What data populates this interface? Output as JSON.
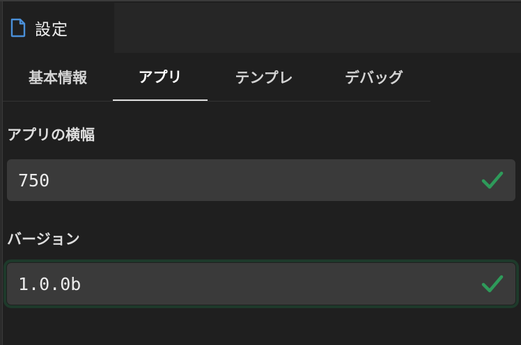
{
  "window": {
    "tab_title": "設定",
    "tab_icon": "file-icon"
  },
  "settings_tabs": [
    {
      "label": "基本情報",
      "active": false
    },
    {
      "label": "アプリ",
      "active": true
    },
    {
      "label": "テンプレ",
      "active": false
    },
    {
      "label": "デバッグ",
      "active": false
    }
  ],
  "form": {
    "app_width": {
      "label": "アプリの横幅",
      "value": "750",
      "status_icon": "check-icon"
    },
    "version": {
      "label": "バージョン",
      "value": "1.0.0b",
      "status_icon": "check-icon"
    }
  },
  "colors": {
    "background": "#1f1f1f",
    "input_background": "#3a3a3a",
    "valid_check": "#2e9a5a",
    "file_icon": "#4a90d9"
  }
}
